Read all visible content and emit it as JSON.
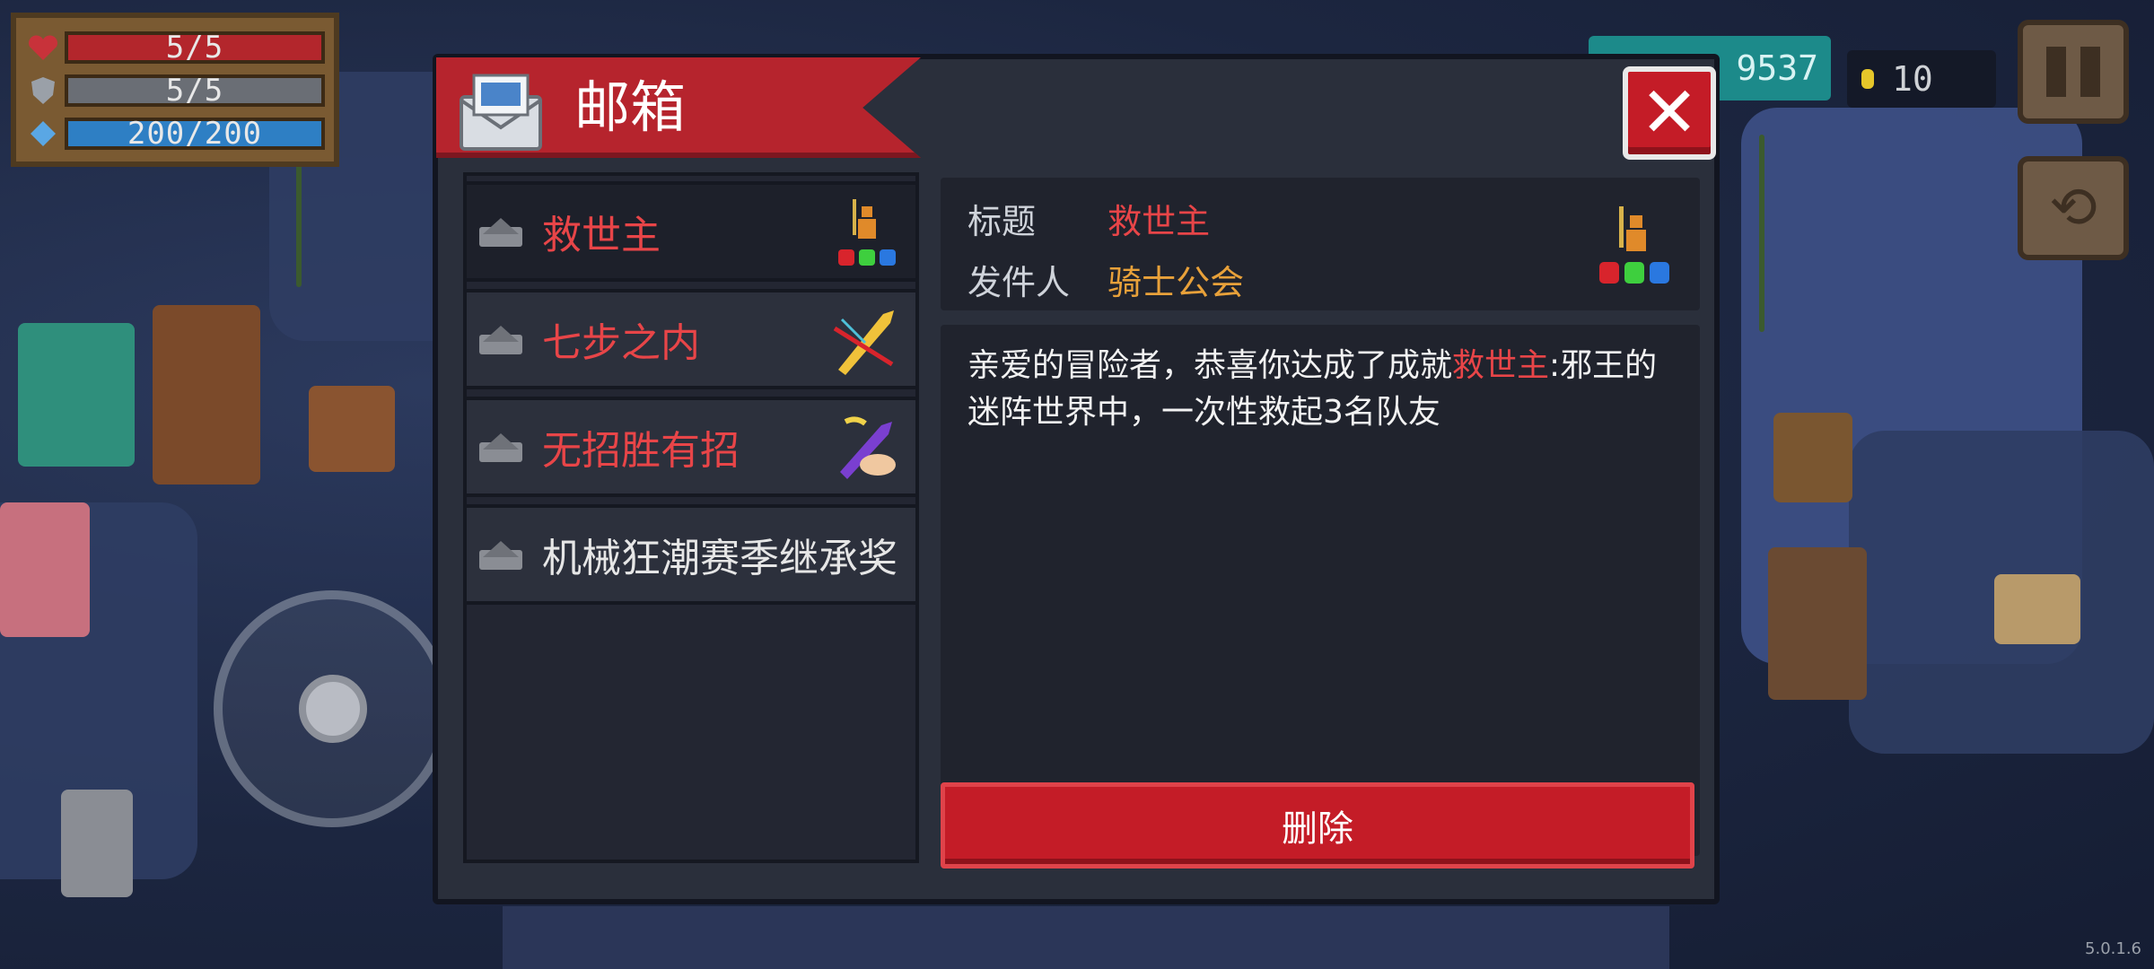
{
  "hud": {
    "health": "5/5",
    "armor": "5/5",
    "energy": "200/200",
    "health_icon": "heart-icon",
    "armor_icon": "shield-icon",
    "energy_icon": "energy-crystal-icon"
  },
  "top_right": {
    "gems": "9537",
    "coins": "10",
    "coin_icon": "coin-icon",
    "pause_icon": "pause-icon",
    "switch_icon": "switch-character-icon"
  },
  "mailbox": {
    "title": "邮箱",
    "title_icon": "mail-envelope-icon",
    "close_icon": "close-icon",
    "items": [
      {
        "label": "救世主",
        "read": false,
        "thumb": "savior-figure-icon"
      },
      {
        "label": "七步之内",
        "read": false,
        "thumb": "sword-slash-icon"
      },
      {
        "label": "无招胜有招",
        "read": false,
        "thumb": "purple-sword-hand-icon"
      },
      {
        "label": "机械狂潮赛季继承奖",
        "read": true,
        "thumb": ""
      }
    ],
    "detail": {
      "subject_label": "标题",
      "subject_value": "救世主",
      "sender_label": "发件人",
      "sender_value": "骑士公会",
      "icon": "savior-figure-icon",
      "body_before": "亲爱的冒险者，恭喜你达成了成就",
      "body_highlight": "救世主",
      "body_after": ":邪王的迷阵世界中，一次性救起3名队友"
    },
    "delete_label": "删除"
  },
  "version": "5.0.1.6",
  "colors": {
    "accent_red": "#c41c27",
    "highlight_red": "#e84548",
    "sender_gold": "#e8a13a",
    "panel_bg": "#2a2f3b"
  }
}
